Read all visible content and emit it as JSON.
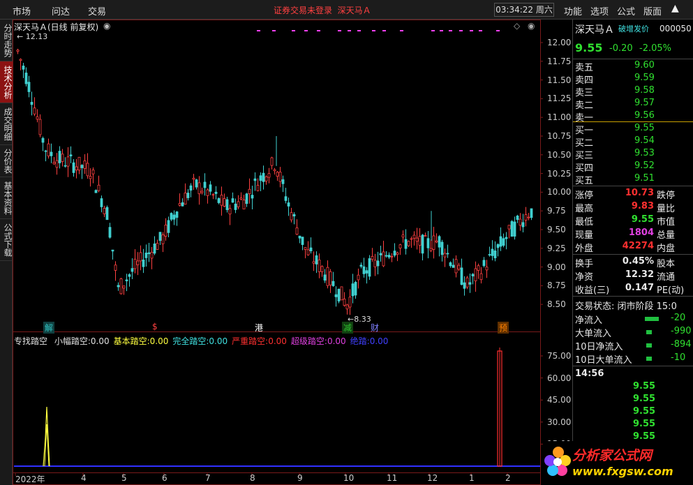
{
  "topbar": {
    "menu": [
      "市场",
      "问达",
      "交易"
    ],
    "center_msg": "证券交易未登录",
    "center_stock": "深天马Ａ",
    "clock": "03:34:22 周六",
    "rmenu": [
      "功能",
      "选项",
      "公式",
      "版面"
    ],
    "chevron": "▲"
  },
  "vtabs": [
    "分时走势",
    "技术分析",
    "成交明细",
    "分价表",
    "基本资料",
    "公式下载"
  ],
  "chart": {
    "title": "深天马Ａ(日线 前复权)",
    "high_marker": "12.13",
    "low_marker": "8.33",
    "price_ticks": [
      "12.00",
      "11.75",
      "11.50",
      "11.25",
      "11.00",
      "10.75",
      "10.50",
      "10.25",
      "10.00",
      "9.75",
      "9.50",
      "9.25",
      "9.00",
      "8.75",
      "8.50"
    ],
    "event_marks": [
      {
        "text": "解",
        "color": "#30c0c0"
      },
      {
        "text": "$",
        "color": "#ff4040"
      },
      {
        "text": "港",
        "color": "#ffffff"
      },
      {
        "text": "减",
        "color": "#30c030"
      },
      {
        "text": "财",
        "color": "#8080ff"
      },
      {
        "text": "预",
        "color": "#ff8000"
      }
    ],
    "indicator": {
      "name": "专找踏空",
      "items": [
        {
          "label": "小幅踏空:",
          "value": "0.00",
          "color": "#e0e0e0"
        },
        {
          "label": "基本踏空:",
          "value": "0.00",
          "color": "#ffff40"
        },
        {
          "label": "完全踏空:",
          "value": "0.00",
          "color": "#40e0e0"
        },
        {
          "label": "严重踏空:",
          "value": "0.00",
          "color": "#ff3030"
        },
        {
          "label": "超级踏空:",
          "value": "0.00",
          "color": "#e040e0"
        },
        {
          "label": "绝踏:",
          "value": "0.00",
          "color": "#4040ff"
        }
      ],
      "ticks": [
        "75.00",
        "60.00",
        "45.00",
        "30.00",
        "15.00"
      ]
    },
    "x_labels": [
      "2022年",
      "4",
      "5",
      "6",
      "7",
      "8",
      "9",
      "10",
      "11",
      "12",
      "1",
      "2"
    ]
  },
  "panel": {
    "name": "深天马Ａ",
    "tag": "破增发价",
    "code": "000050",
    "price": "9.55",
    "change": "-0.20",
    "change_pct": "-2.05%",
    "asks": [
      {
        "label": "卖五",
        "price": "9.60"
      },
      {
        "label": "卖四",
        "price": "9.59"
      },
      {
        "label": "卖三",
        "price": "9.58"
      },
      {
        "label": "卖二",
        "price": "9.57"
      },
      {
        "label": "卖一",
        "price": "9.56"
      }
    ],
    "bids": [
      {
        "label": "买一",
        "price": "9.55"
      },
      {
        "label": "买二",
        "price": "9.54"
      },
      {
        "label": "买三",
        "price": "9.53"
      },
      {
        "label": "买四",
        "price": "9.52"
      },
      {
        "label": "买五",
        "price": "9.51"
      }
    ],
    "stats": [
      {
        "label": "涨停",
        "value": "10.73",
        "color": "#ff3030",
        "right": "跌停"
      },
      {
        "label": "最高",
        "value": "9.83",
        "color": "#ff3030",
        "right": "量比"
      },
      {
        "label": "最低",
        "value": "9.55",
        "color": "#30e030",
        "right": "市值"
      },
      {
        "label": "现量",
        "value": "1804",
        "color": "#e040e0",
        "right": "总量"
      },
      {
        "label": "外盘",
        "value": "42274",
        "color": "#ff3030",
        "right": "内盘"
      }
    ],
    "stats2": [
      {
        "label": "换手",
        "value": "0.45%",
        "right": "股本"
      },
      {
        "label": "净资",
        "value": "12.32",
        "right": "流通"
      },
      {
        "label": "收益(三)",
        "value": "0.147",
        "right": "PE(动)"
      }
    ],
    "trade_state": "交易状态: 闭市阶段 15:0",
    "flows": [
      {
        "label": "净流入",
        "value": "-20"
      },
      {
        "label": "大单流入",
        "value": "-990"
      },
      {
        "label": "10日净流入",
        "value": "-894"
      },
      {
        "label": "10日大单流入",
        "value": "-10"
      }
    ],
    "ticks_time": "14:56",
    "tick_prices": [
      "9.55",
      "9.55",
      "9.55",
      "9.55",
      "9.55",
      "9.55"
    ]
  },
  "logo": {
    "text": "分析家公式网",
    "url": "www.fxgsw.com"
  }
}
